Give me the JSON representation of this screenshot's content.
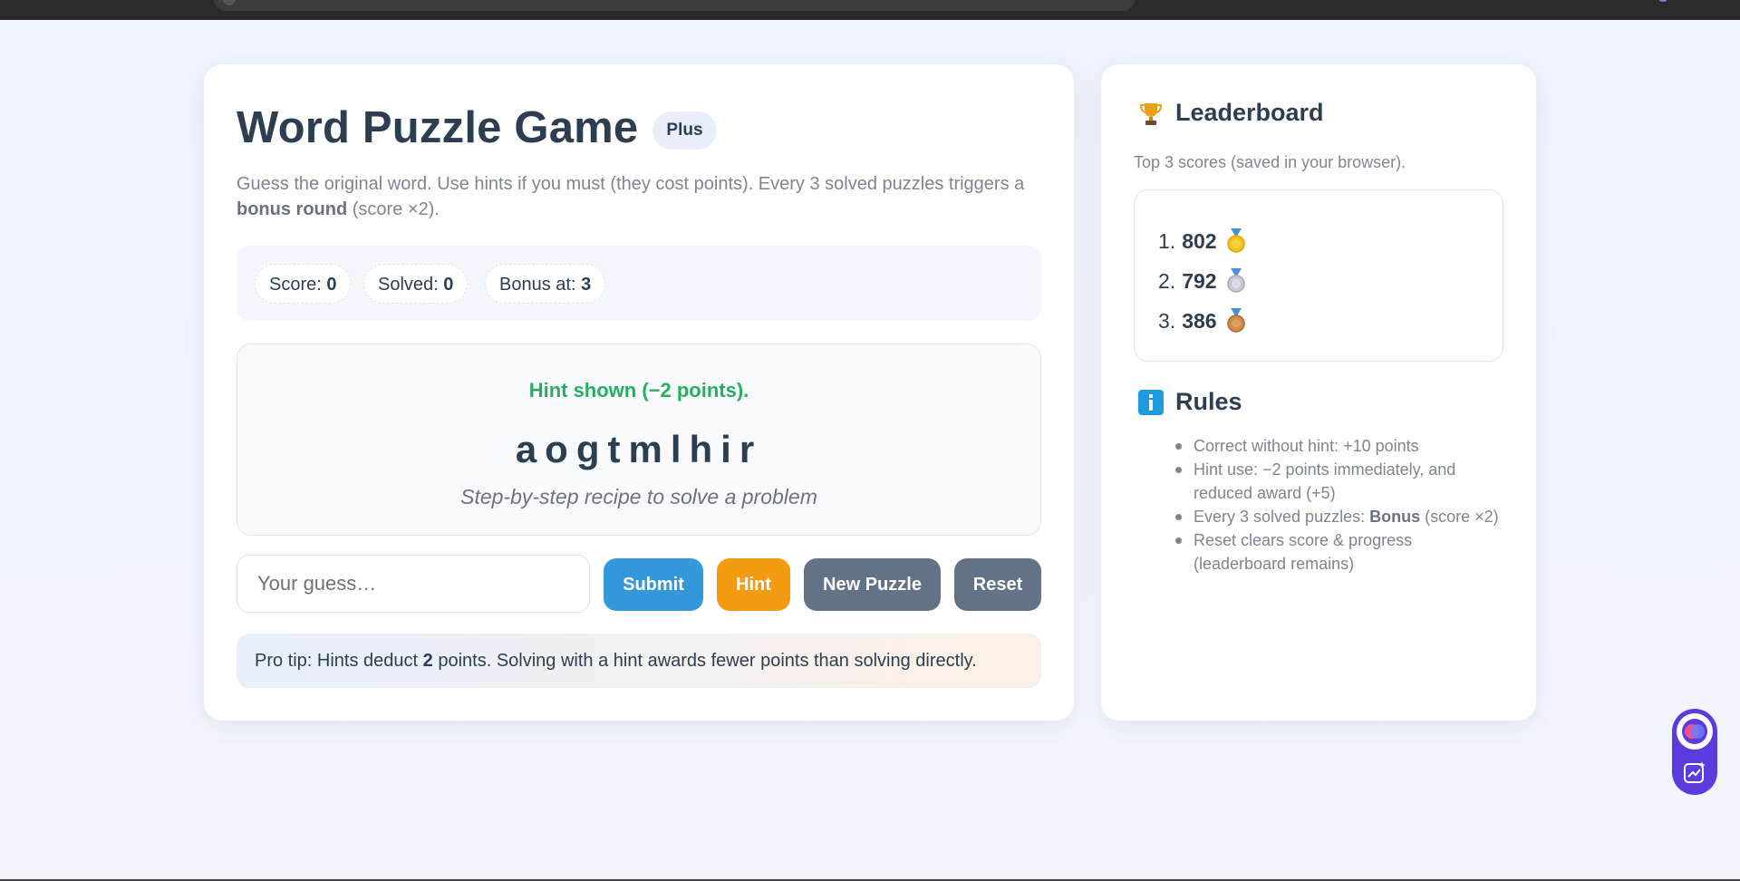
{
  "title": "Word Puzzle Game",
  "badge": "Plus",
  "subtitle": {
    "part1": "Guess the original word. Use hints if you must (they cost points). Every 3 solved puzzles triggers a ",
    "bold": "bonus round",
    "part2": " (score ×2)."
  },
  "stats": {
    "score_label": "Score: ",
    "score": "0",
    "solved_label": "Solved: ",
    "solved": "0",
    "bonus_label": "Bonus at: ",
    "bonus": "3"
  },
  "puzzle": {
    "feedback": "Hint shown (−2 points).",
    "scrambled": "aogtmlhir",
    "hint": "Step-by-step recipe to solve a problem"
  },
  "guess": {
    "placeholder": "Your guess…",
    "value": ""
  },
  "buttons": {
    "submit": "Submit",
    "hint": "Hint",
    "new_puzzle": "New Puzzle",
    "reset": "Reset"
  },
  "protip": {
    "part1": "Pro tip: Hints deduct ",
    "bold": "2",
    "part2": " points. Solving with a hint awards fewer points than solving directly."
  },
  "leaderboard": {
    "title": "Leaderboard",
    "subtitle": "Top 3 scores (saved in your browser).",
    "entries": [
      {
        "rank": "1.",
        "score": "802",
        "medal": "gold-medal-icon"
      },
      {
        "rank": "2.",
        "score": "792",
        "medal": "silver-medal-icon"
      },
      {
        "rank": "3.",
        "score": "386",
        "medal": "bronze-medal-icon"
      }
    ]
  },
  "rules": {
    "title": "Rules",
    "items": [
      {
        "text": "Correct without hint: +10 points"
      },
      {
        "text": "Hint use: −2 points immediately, and reduced award (+5)"
      },
      {
        "pre": "Every 3 solved puzzles: ",
        "bold": "Bonus",
        "post": " (score ×2)"
      },
      {
        "text": "Reset clears score & progress (leaderboard remains)"
      }
    ]
  },
  "colors": {
    "accent_blue": "#3498db",
    "hint_orange": "#f39c12",
    "neutral_button": "#647287",
    "success_green": "#27ae60",
    "heading": "#2c3e50"
  },
  "icons": {
    "leaderboard": "trophy-icon",
    "rules": "info-icon",
    "widget_top": "assistant-orb-icon",
    "widget_bottom": "chart-sparkle-icon"
  }
}
